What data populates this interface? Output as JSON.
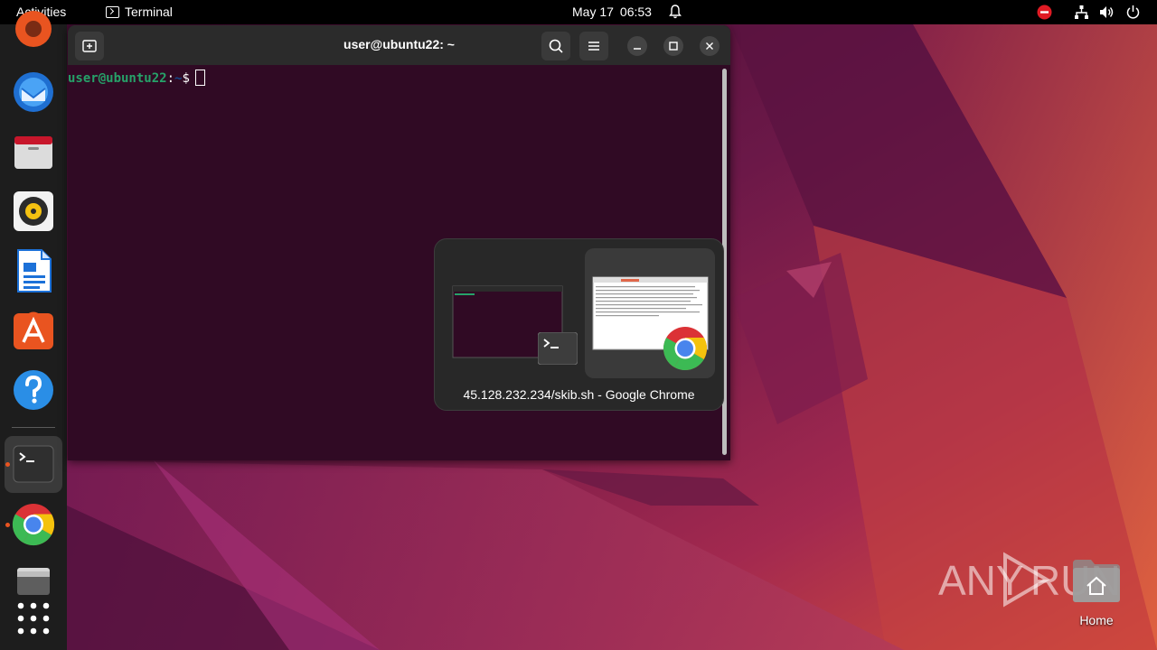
{
  "topbar": {
    "activities": "Activities",
    "app_name": "Terminal",
    "date": "May 17",
    "time": "06:53"
  },
  "dock": {
    "items": [
      {
        "name": "ubuntu-software-partial",
        "icon": "app-icon"
      },
      {
        "name": "thunderbird",
        "icon": "thunderbird-icon"
      },
      {
        "name": "files",
        "icon": "files-icon"
      },
      {
        "name": "rhythmbox",
        "icon": "rhythmbox-icon"
      },
      {
        "name": "libreoffice-writer",
        "icon": "writer-icon"
      },
      {
        "name": "app-center",
        "icon": "app-center-icon"
      },
      {
        "name": "help",
        "icon": "help-icon"
      },
      {
        "name": "terminal",
        "icon": "terminal-icon",
        "running": true,
        "active": true
      },
      {
        "name": "google-chrome",
        "icon": "chrome-icon",
        "running": true
      },
      {
        "name": "trash-or-drive",
        "icon": "drive-icon"
      },
      {
        "name": "show-apps",
        "icon": "grid-icon"
      }
    ]
  },
  "terminal": {
    "title": "user@ubuntu22: ~",
    "prompt_user": "user@ubuntu22",
    "prompt_sep": ":",
    "prompt_path": "~",
    "prompt_symbol": "$"
  },
  "switcher": {
    "selected_label": "45.128.232.234/skib.sh - Google Chrome",
    "items": [
      {
        "app": "terminal",
        "icon": "terminal-icon"
      },
      {
        "app": "google-chrome",
        "icon": "chrome-icon",
        "selected": true
      }
    ]
  },
  "desktop": {
    "home_label": "Home"
  },
  "watermark": {
    "text_left": "ANY",
    "text_right": "RUN"
  },
  "colors": {
    "accent_orange": "#e95420",
    "terminal_bg": "#300a24",
    "prompt_green": "#26a269",
    "prompt_blue": "#12488b"
  }
}
